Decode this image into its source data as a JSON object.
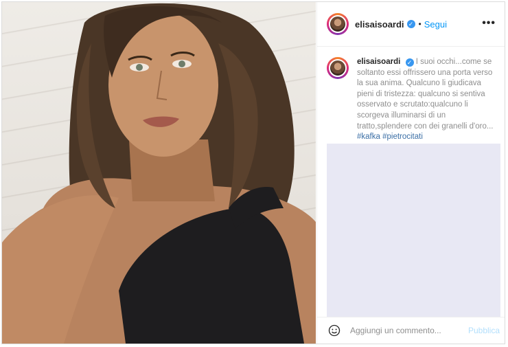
{
  "post": {
    "username": "elisaisoardi",
    "verified_icon": "verified-badge-icon",
    "follow_label": "Segui",
    "separator": "•",
    "more_icon": "more-options-icon",
    "more_label": "•••"
  },
  "caption": {
    "username": "elisaisoardi",
    "text": "I suoi occhi...come se soltanto essi offrissero una porta verso la sua anima. Qualcuno li giudicava pieni di tristezza: qualcuno si sentiva osservato e scrutato:qualcuno li scorgeva illuminarsi di un tratto,splendere con dei granelli d'oro...",
    "hashtags": [
      "#kafka",
      "#pietrocitati"
    ]
  },
  "comment": {
    "emoji_icon": "emoji-icon",
    "placeholder": "Aggiungi un commento...",
    "publish_label": "Pubblica"
  },
  "colors": {
    "accent": "#0095f6",
    "verified": "#3897f0",
    "publish_disabled": "#b2dffc",
    "placeholder_box": "#e8e8f4"
  }
}
